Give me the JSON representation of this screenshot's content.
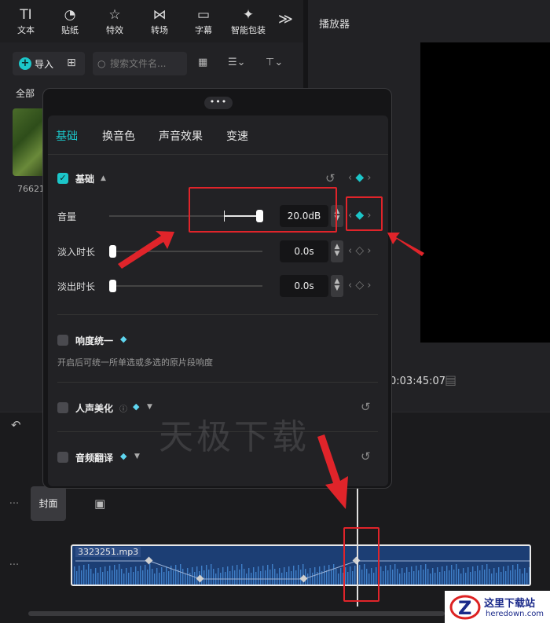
{
  "toolbar": {
    "items": [
      {
        "label": "文本",
        "glyph": "TI",
        "icon": "text-icon"
      },
      {
        "label": "贴纸",
        "glyph": "◔",
        "icon": "sticker-icon"
      },
      {
        "label": "特效",
        "glyph": "☆",
        "icon": "effects-icon"
      },
      {
        "label": "转场",
        "glyph": "⋈",
        "icon": "transition-icon"
      },
      {
        "label": "字幕",
        "glyph": "▭",
        "icon": "subtitle-icon"
      },
      {
        "label": "智能包装",
        "glyph": "✦",
        "icon": "smart-pack-icon"
      }
    ],
    "more_glyph": "≫"
  },
  "media": {
    "import_label": "导入",
    "search_placeholder": "搜索文件名...",
    "filter_all": "全部",
    "thumb_label": "76621"
  },
  "player": {
    "title": "播放器",
    "timecode": "0:03:45:07"
  },
  "popup": {
    "dots": "•••",
    "tabs": [
      "基础",
      "换音色",
      "声音效果",
      "变速"
    ],
    "active_tab": 0,
    "basic_section": "基础",
    "rows": [
      {
        "label": "音量",
        "value": "20.0dB",
        "level": 1.0
      },
      {
        "label": "淡入时长",
        "value": "0.0s",
        "level": 0.0
      },
      {
        "label": "淡出时长",
        "value": "0.0s",
        "level": 0.0
      }
    ],
    "loudness": {
      "title": "响度统一",
      "desc": "开启后可统一所单选或多选的原片段响度"
    },
    "voice_beautify": {
      "title": "人声美化"
    },
    "audio_translate": {
      "title": "音频翻译"
    }
  },
  "timeline": {
    "cover_label": "封面",
    "clip_name": "3323251.mp3"
  },
  "watermark": "天极下载",
  "corner": {
    "title": "这里下载站",
    "url": "heredown.com"
  },
  "colors": {
    "accent": "#1cc6c9",
    "highlight": "#e0242a",
    "clip": "#1c3e74"
  }
}
